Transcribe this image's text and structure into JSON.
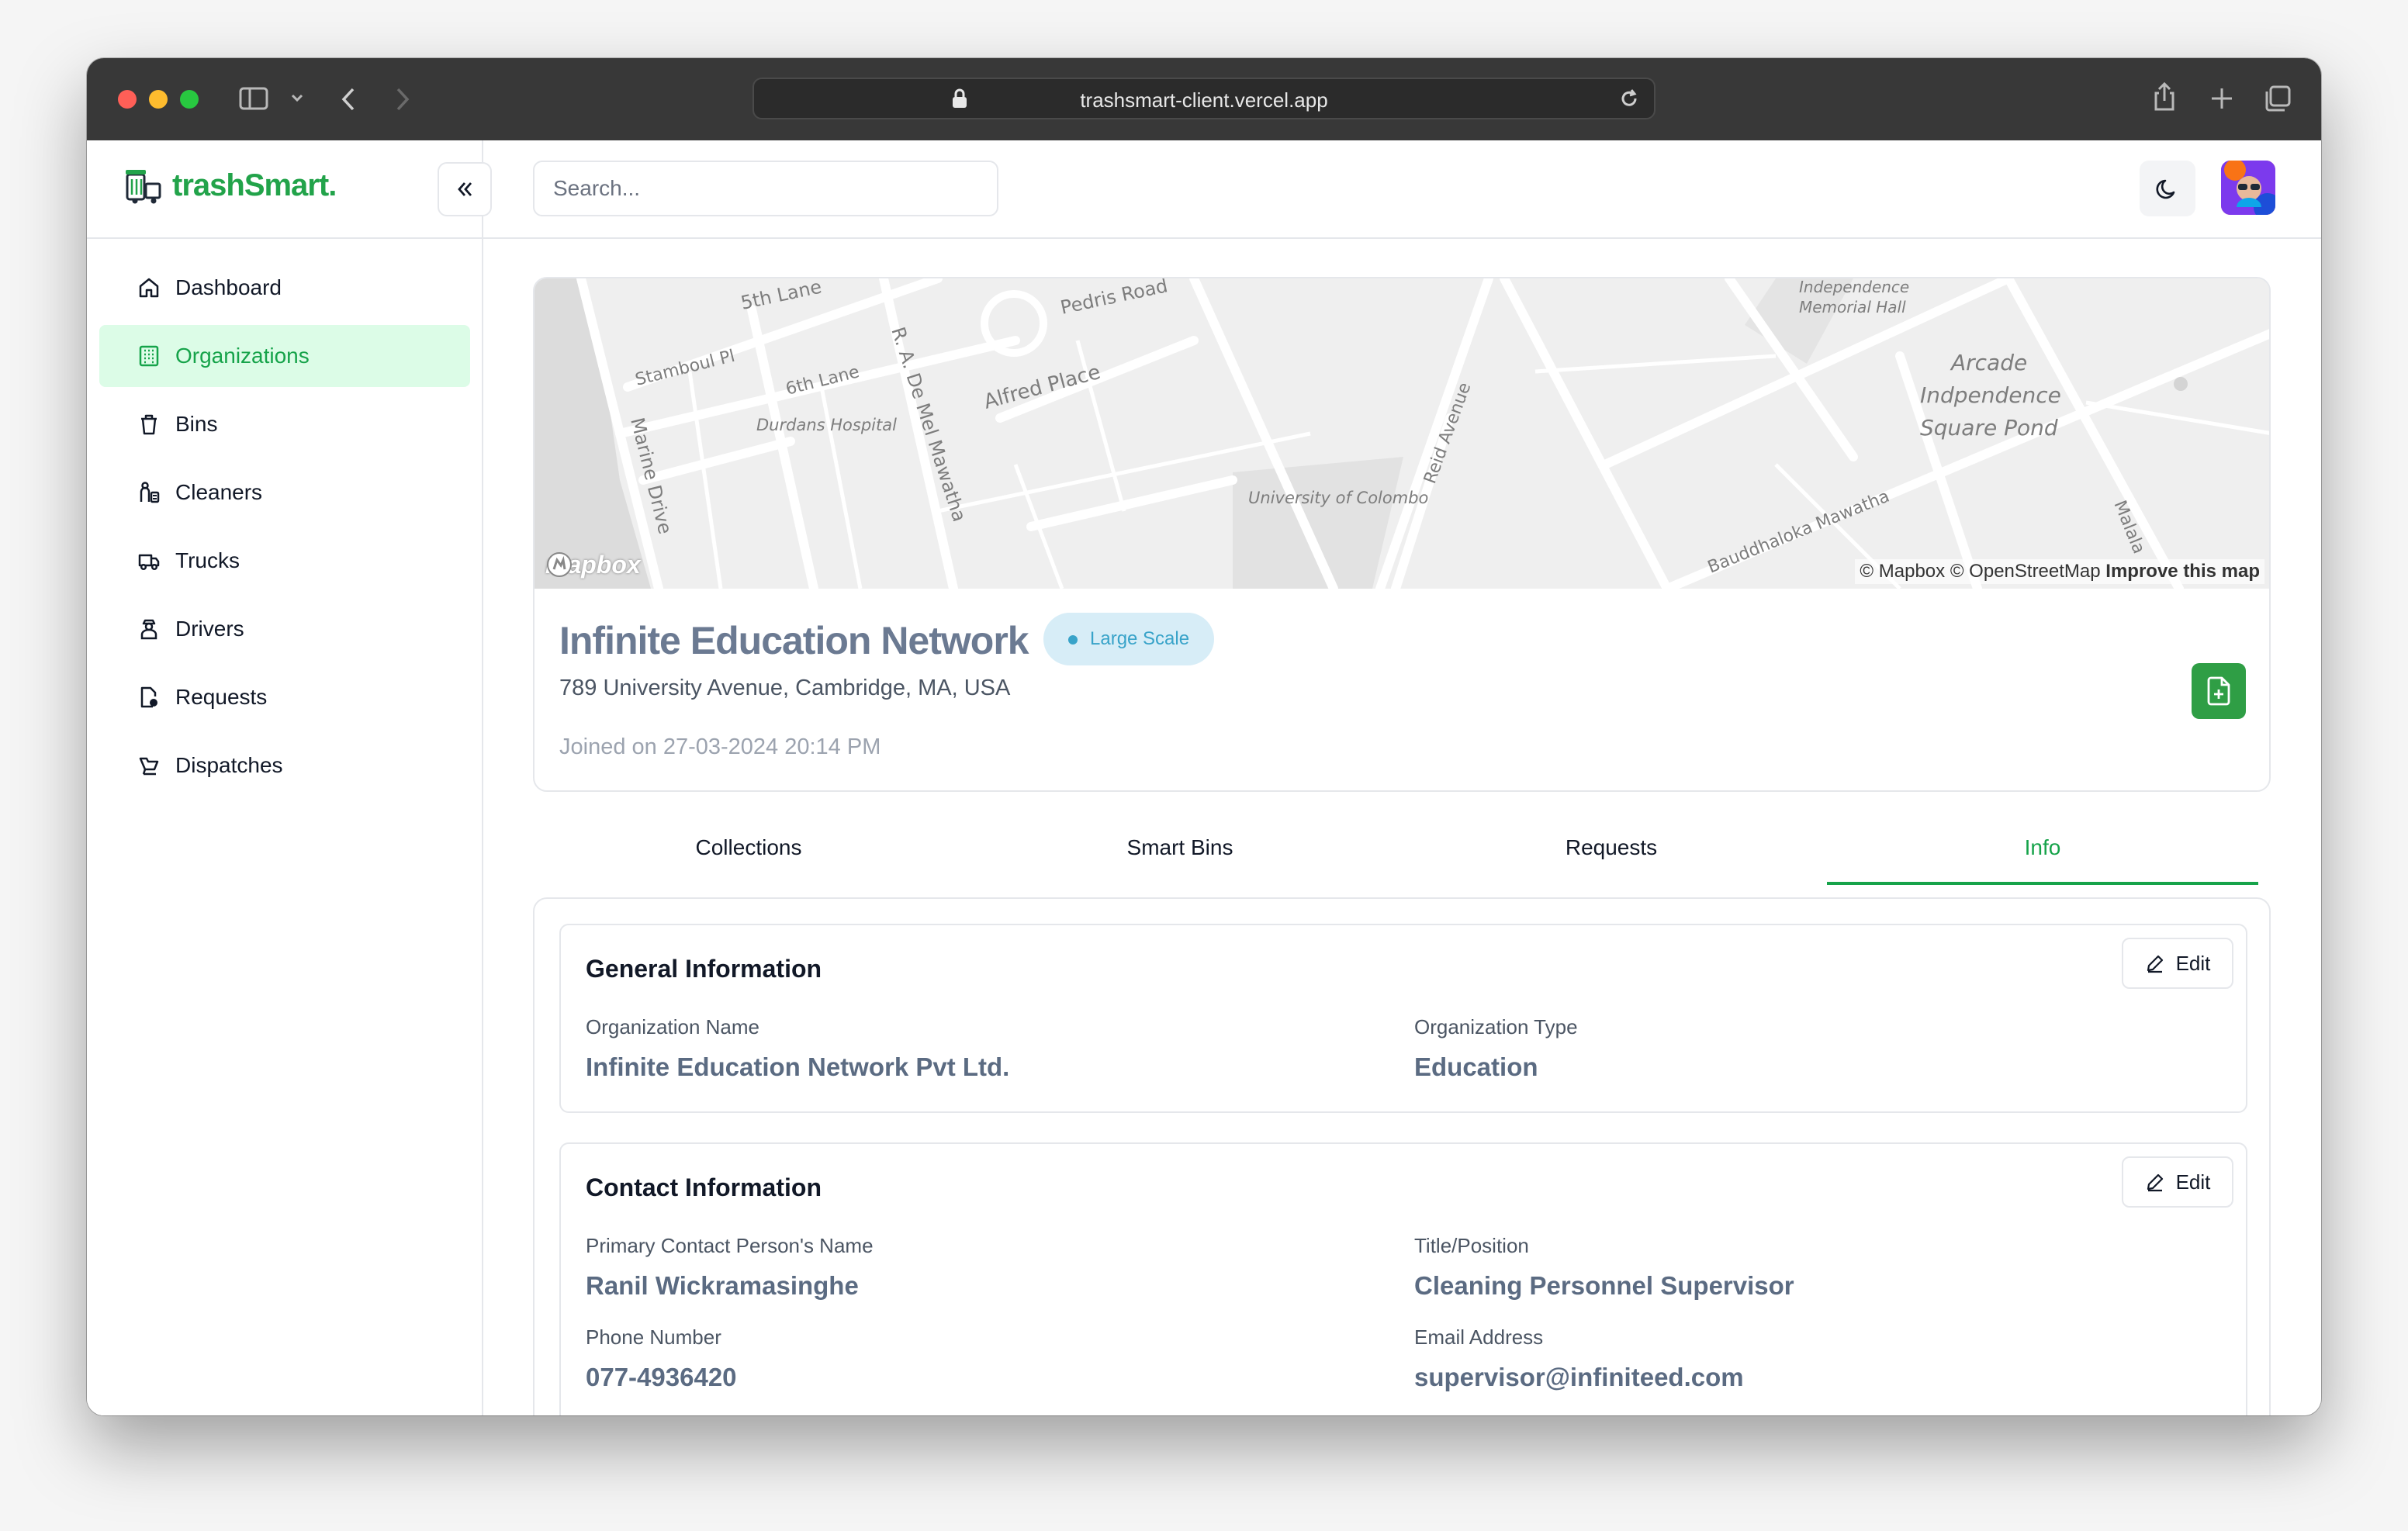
{
  "browser": {
    "url": "trashsmart-client.vercel.app"
  },
  "brand": {
    "name": "trashSmart",
    "dot": ".",
    "accent": "#16a34a"
  },
  "sidebar": {
    "items": [
      {
        "label": "Dashboard",
        "icon": "home-icon",
        "active": false
      },
      {
        "label": "Organizations",
        "icon": "building-icon",
        "active": true
      },
      {
        "label": "Bins",
        "icon": "trash-icon",
        "active": false
      },
      {
        "label": "Cleaners",
        "icon": "cleaner-icon",
        "active": false
      },
      {
        "label": "Trucks",
        "icon": "truck-icon",
        "active": false
      },
      {
        "label": "Drivers",
        "icon": "driver-icon",
        "active": false
      },
      {
        "label": "Requests",
        "icon": "request-icon",
        "active": false
      },
      {
        "label": "Dispatches",
        "icon": "dispatch-icon",
        "active": false
      }
    ]
  },
  "topbar": {
    "search_placeholder": "Search..."
  },
  "map": {
    "labels": [
      "5th Lane",
      "Pedris Road",
      "Stamboul Pl",
      "6th Lane",
      "Durdans Hospital",
      "Alfred Place",
      "R. A. De Mel Mawatha",
      "Marine Drive",
      "University of Colombo",
      "Reid Avenue",
      "Independence",
      "Memorial Hall",
      "Arcade",
      "Indpendence",
      "Square Pond",
      "Bauddhaloka Mawatha",
      "Malala"
    ],
    "attribution": "© Mapbox © OpenStreetMap",
    "improve": "Improve this map",
    "logo": "mapbox"
  },
  "organization": {
    "name": "Infinite Education Network",
    "scale": "Large Scale",
    "address": "789 University Avenue, Cambridge, MA, USA",
    "joined": "Joined on 27-03-2024 20:14 PM"
  },
  "tabs": [
    {
      "label": "Collections",
      "active": false
    },
    {
      "label": "Smart Bins",
      "active": false
    },
    {
      "label": "Requests",
      "active": false
    },
    {
      "label": "Info",
      "active": true
    }
  ],
  "general": {
    "title": "General Information",
    "edit": "Edit",
    "org_name_label": "Organization Name",
    "org_name_value": "Infinite Education Network Pvt Ltd.",
    "org_type_label": "Organization Type",
    "org_type_value": "Education"
  },
  "contact": {
    "title": "Contact Information",
    "edit": "Edit",
    "person_label": "Primary Contact Person's Name",
    "person_value": "Ranil Wickramasinghe",
    "position_label": "Title/Position",
    "position_value": "Cleaning Personnel Supervisor",
    "phone_label": "Phone Number",
    "phone_value": "077-4936420",
    "email_label": "Email Address",
    "email_value": "supervisor@infiniteed.com"
  }
}
